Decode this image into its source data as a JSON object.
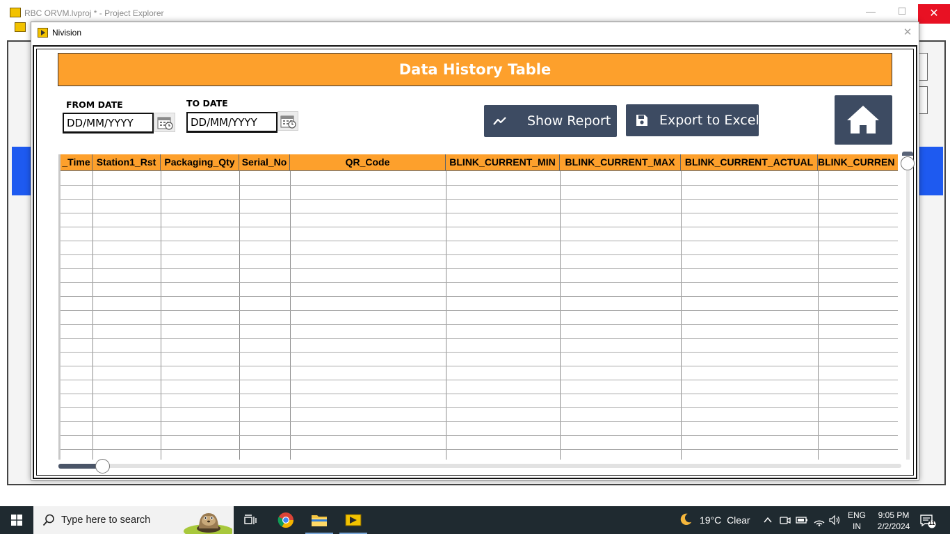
{
  "background_window": {
    "title": "RBC ORVM.lvproj * - Project Explorer",
    "min_icon": "minimize-icon",
    "max_icon": "maximize-icon",
    "close_glyph": "✕"
  },
  "dialog": {
    "title": "Nivision",
    "close_glyph": "✕"
  },
  "header": {
    "title": "Data History Table",
    "accent_color": "#fda02c"
  },
  "filters": {
    "from_label": "FROM DATE",
    "from_value": "DD/MM/YYYY",
    "to_label": "TO DATE",
    "to_value": "DD/MM/YYYY"
  },
  "actions": {
    "show_report": "Show Report",
    "export_excel": "Export to Excel",
    "home_icon": "home-icon",
    "button_color": "#3d4b62"
  },
  "table": {
    "columns": [
      "_Time",
      "Station1_Rst",
      "Packaging_Qty",
      "Serial_No",
      "QR_Code",
      "BLINK_CURRENT_MIN",
      "BLINK_CURRENT_MAX",
      "BLINK_CURRENT_ACTUAL",
      "BLINK_CURREN"
    ],
    "rows": []
  },
  "taskbar": {
    "search_placeholder": "Type here to search",
    "weather_temp": "19°C",
    "weather_condition": "Clear",
    "lang_line1": "ENG",
    "lang_line2": "IN",
    "time": "9:05 PM",
    "date": "2/2/2024",
    "notification_count": "11"
  }
}
